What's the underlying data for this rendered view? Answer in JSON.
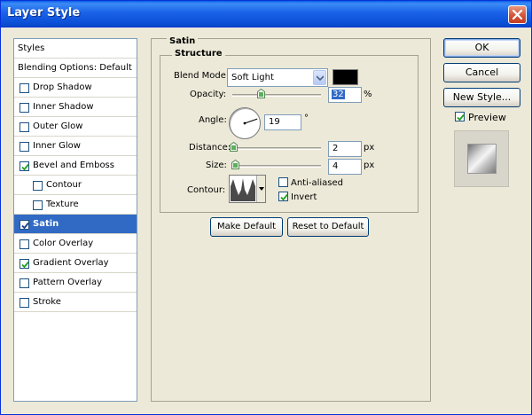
{
  "window": {
    "title": "Layer Style"
  },
  "styles_list": {
    "items": [
      {
        "label": "Styles",
        "has_checkbox": false,
        "checked": false,
        "selected": false,
        "indent": 0
      },
      {
        "label": "Blending Options: Default",
        "has_checkbox": false,
        "checked": false,
        "selected": false,
        "indent": 0
      },
      {
        "label": "Drop Shadow",
        "has_checkbox": true,
        "checked": false,
        "selected": false,
        "indent": 0
      },
      {
        "label": "Inner Shadow",
        "has_checkbox": true,
        "checked": false,
        "selected": false,
        "indent": 0
      },
      {
        "label": "Outer Glow",
        "has_checkbox": true,
        "checked": false,
        "selected": false,
        "indent": 0
      },
      {
        "label": "Inner Glow",
        "has_checkbox": true,
        "checked": false,
        "selected": false,
        "indent": 0
      },
      {
        "label": "Bevel and Emboss",
        "has_checkbox": true,
        "checked": true,
        "selected": false,
        "indent": 0
      },
      {
        "label": "Contour",
        "has_checkbox": true,
        "checked": false,
        "selected": false,
        "indent": 1
      },
      {
        "label": "Texture",
        "has_checkbox": true,
        "checked": false,
        "selected": false,
        "indent": 1
      },
      {
        "label": "Satin",
        "has_checkbox": true,
        "checked": true,
        "selected": true,
        "indent": 0
      },
      {
        "label": "Color Overlay",
        "has_checkbox": true,
        "checked": false,
        "selected": false,
        "indent": 0
      },
      {
        "label": "Gradient Overlay",
        "has_checkbox": true,
        "checked": true,
        "selected": false,
        "indent": 0
      },
      {
        "label": "Pattern Overlay",
        "has_checkbox": true,
        "checked": false,
        "selected": false,
        "indent": 0
      },
      {
        "label": "Stroke",
        "has_checkbox": true,
        "checked": false,
        "selected": false,
        "indent": 0
      }
    ]
  },
  "satin": {
    "group_label": "Satin",
    "structure_label": "Structure",
    "blend_mode": {
      "label": "Blend Mode:",
      "value": "Soft Light",
      "color": "#000000"
    },
    "opacity": {
      "label": "Opacity:",
      "value": "32",
      "unit": "%",
      "fraction": 0.32
    },
    "angle": {
      "label": "Angle:",
      "value": "19",
      "unit": "°",
      "degrees": 19
    },
    "distance": {
      "label": "Distance:",
      "value": "2",
      "unit": "px",
      "fraction": 0.01
    },
    "size": {
      "label": "Size:",
      "value": "4",
      "unit": "px",
      "fraction": 0.03
    },
    "contour": {
      "label": "Contour:"
    },
    "anti_aliased": {
      "label": "Anti-aliased",
      "checked": false
    },
    "invert": {
      "label": "Invert",
      "checked": true
    },
    "make_default": "Make Default",
    "reset_default": "Reset to Default"
  },
  "buttons": {
    "ok": "OK",
    "cancel": "Cancel",
    "new_style": "New Style..."
  },
  "preview": {
    "label": "Preview",
    "checked": true
  },
  "colors": {
    "selection": "#316ac5",
    "title_bar": "#0a5fe6",
    "face": "#ece9d8"
  }
}
